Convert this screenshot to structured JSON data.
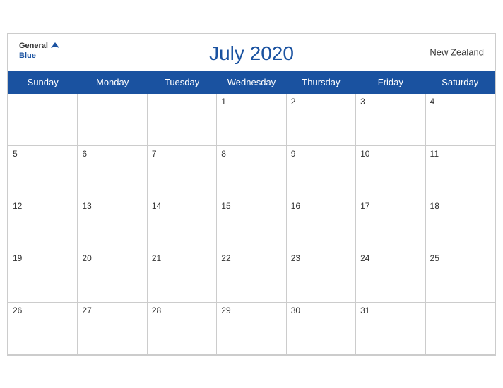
{
  "header": {
    "title": "July 2020",
    "country": "New Zealand",
    "logo": {
      "general": "General",
      "blue": "Blue"
    }
  },
  "days_of_week": [
    "Sunday",
    "Monday",
    "Tuesday",
    "Wednesday",
    "Thursday",
    "Friday",
    "Saturday"
  ],
  "weeks": [
    [
      null,
      null,
      null,
      1,
      2,
      3,
      4
    ],
    [
      5,
      6,
      7,
      8,
      9,
      10,
      11
    ],
    [
      12,
      13,
      14,
      15,
      16,
      17,
      18
    ],
    [
      19,
      20,
      21,
      22,
      23,
      24,
      25
    ],
    [
      26,
      27,
      28,
      29,
      30,
      31,
      null
    ]
  ],
  "accent_color": "#1a52a0"
}
